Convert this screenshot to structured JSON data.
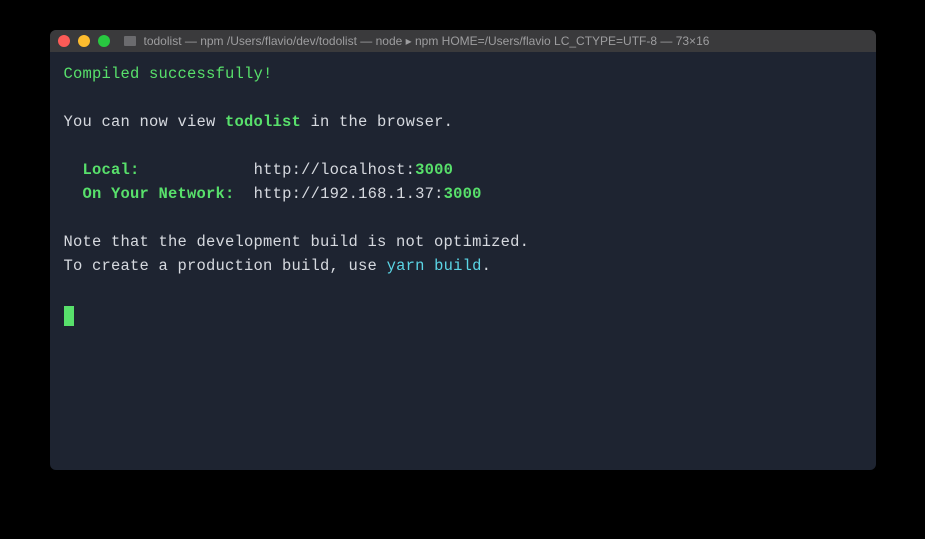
{
  "window": {
    "title": "todolist — npm /Users/flavio/dev/todolist — node ▸ npm HOME=/Users/flavio LC_CTYPE=UTF-8 — 73×16"
  },
  "output": {
    "compiled": "Compiled successfully!",
    "view_prefix": "You can now view ",
    "app_name": "todolist",
    "view_suffix": " in the browser.",
    "local_label": "Local:",
    "local_url_prefix": "http://localhost:",
    "local_port": "3000",
    "network_label": "On Your Network:",
    "network_url_prefix": "http://192.168.1.37:",
    "network_port": "3000",
    "note1": "Note that the development build is not optimized.",
    "note2_prefix": "To create a production build, use ",
    "build_cmd": "yarn build",
    "note2_suffix": "."
  }
}
